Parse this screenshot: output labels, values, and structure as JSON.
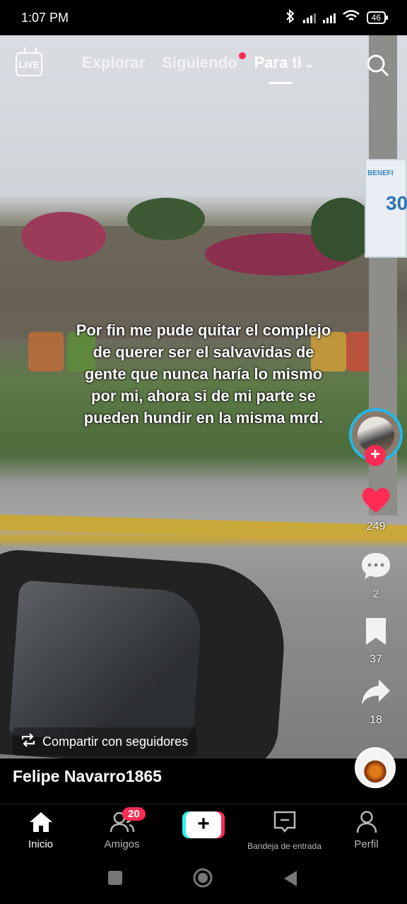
{
  "status_bar": {
    "time": "1:07 PM",
    "battery": "46"
  },
  "top_nav": {
    "live_label": "LIVE",
    "tabs": [
      {
        "label": "Explorar"
      },
      {
        "label": "Siguiendo"
      },
      {
        "label": "Para ti"
      }
    ]
  },
  "video": {
    "sign_text": "BENEFI",
    "sign_number": "30",
    "caption": "Por fin me pude quitar el complejo de querer ser el salvavidas de gente que nunca haría lo mismo por mi, ahora si de mi parte se pueden hundir en la misma mrd."
  },
  "rail": {
    "likes": "249",
    "comments": "2",
    "saves": "37",
    "shares": "18"
  },
  "share_pill": {
    "label": "Compartir con seguidores"
  },
  "user": {
    "username": "Felipe Navarro1865"
  },
  "bottom_nav": {
    "items": [
      {
        "label": "Inicio"
      },
      {
        "label": "Amigos",
        "badge": "20"
      },
      {
        "label": ""
      },
      {
        "label": "Bandeja de entrada"
      },
      {
        "label": "Perfil"
      }
    ]
  },
  "colors": {
    "accent": "#fe2c55",
    "cyan": "#25f4ee",
    "ring": "#21b8e8"
  }
}
